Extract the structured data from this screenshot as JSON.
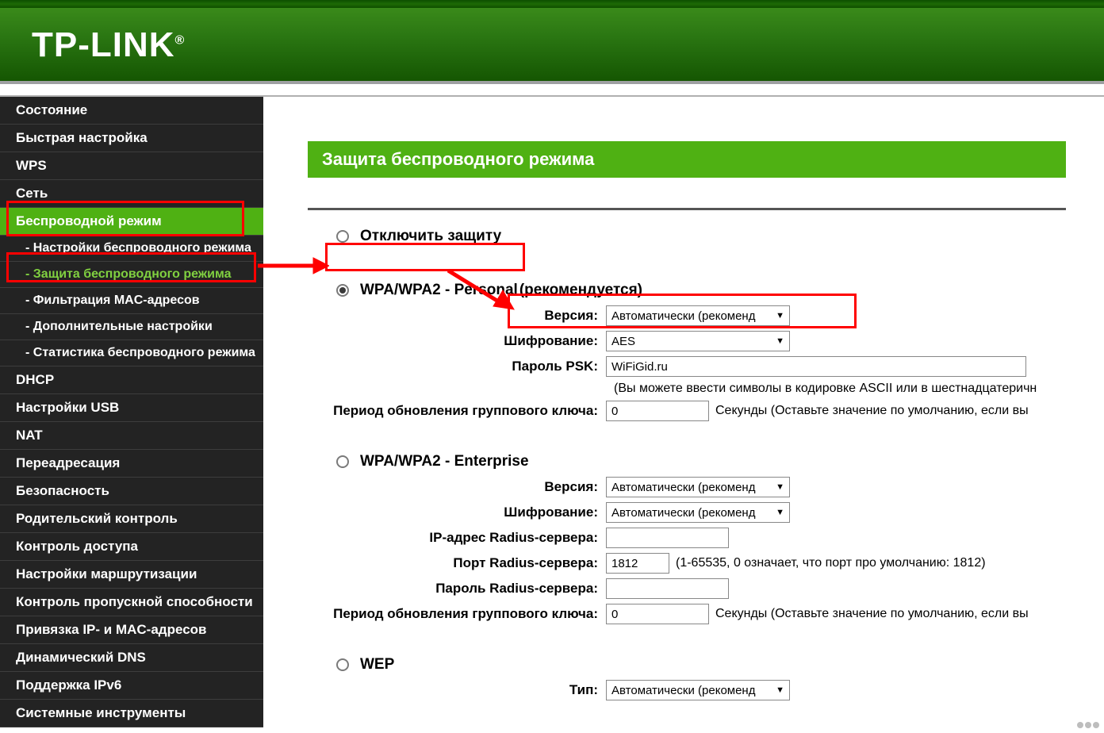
{
  "brand": "TP-LINK",
  "page_title": "Защита беспроводного режима",
  "sidebar": [
    {
      "label": "Состояние"
    },
    {
      "label": "Быстрая настройка"
    },
    {
      "label": "WPS"
    },
    {
      "label": "Сеть"
    },
    {
      "label": "Беспроводной режим",
      "active": true
    },
    {
      "label": "- Настройки беспроводного режима",
      "sub": true
    },
    {
      "label": "- Защита беспроводного режима",
      "sub": true,
      "sub_active": true
    },
    {
      "label": "- Фильтрация MAC-адресов",
      "sub": true
    },
    {
      "label": "- Дополнительные настройки",
      "sub": true
    },
    {
      "label": "- Статистика беспроводного режима",
      "sub": true
    },
    {
      "label": "DHCP"
    },
    {
      "label": "Настройки USB"
    },
    {
      "label": "NAT"
    },
    {
      "label": "Переадресация"
    },
    {
      "label": "Безопасность"
    },
    {
      "label": "Родительский контроль"
    },
    {
      "label": "Контроль доступа"
    },
    {
      "label": "Настройки маршрутизации"
    },
    {
      "label": "Контроль пропускной способности"
    },
    {
      "label": "Привязка IP- и MAC-адресов"
    },
    {
      "label": "Динамический DNS"
    },
    {
      "label": "Поддержка IPv6"
    },
    {
      "label": "Системные инструменты"
    }
  ],
  "options": {
    "disable": {
      "label": "Отключить защиту",
      "checked": false
    },
    "personal": {
      "label": "WPA/WPA2 - Personal",
      "hint": "(рекомендуется)",
      "checked": true,
      "fields": {
        "version_label": "Версия:",
        "version_value": "Автоматически (рекоменд",
        "enc_label": "Шифрование:",
        "enc_value": "AES",
        "psk_label": "Пароль PSK:",
        "psk_value": "WiFiGid.ru",
        "psk_hint": "(Вы можете ввести символы в кодировке ASCII или в шестнадцатеричн",
        "rekey_label": "Период обновления группового ключа:",
        "rekey_value": "0",
        "rekey_hint": "Секунды (Оставьте значение по умолчанию, если вы"
      }
    },
    "enterprise": {
      "label": "WPA/WPA2 - Enterprise",
      "checked": false,
      "fields": {
        "version_label": "Версия:",
        "version_value": "Автоматически (рекоменд",
        "enc_label": "Шифрование:",
        "enc_value": "Автоматически (рекоменд",
        "radius_ip_label": "IP-адрес Radius-сервера:",
        "radius_ip_value": "",
        "radius_port_label": "Порт Radius-сервера:",
        "radius_port_value": "1812",
        "radius_port_hint": "(1-65535, 0 означает, что порт про умолчанию: 1812)",
        "radius_pw_label": "Пароль Radius-сервера:",
        "radius_pw_value": "",
        "rekey_label": "Период обновления группового ключа:",
        "rekey_value": "0",
        "rekey_hint": "Секунды (Оставьте значение по умолчанию, если вы"
      }
    },
    "wep": {
      "label": "WEP",
      "checked": false,
      "fields": {
        "type_label": "Тип:",
        "type_value": "Автоматически (рекоменд"
      }
    }
  }
}
